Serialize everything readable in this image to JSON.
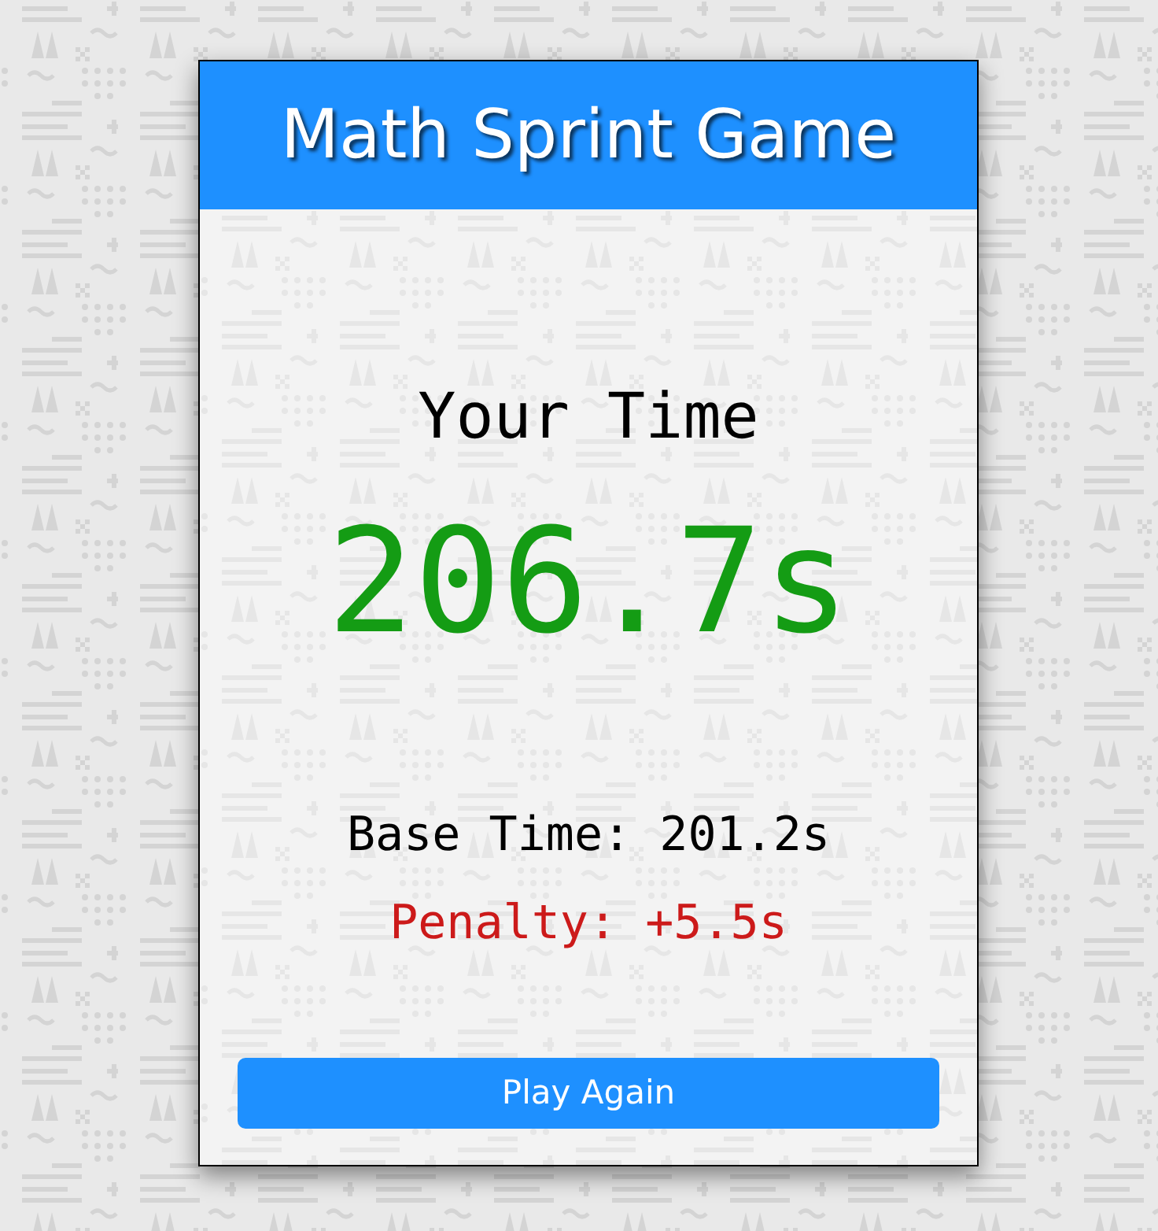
{
  "header": {
    "title": "Math Sprint Game"
  },
  "score": {
    "label": "Your Time",
    "total_time": "206.7s",
    "base_time": "Base Time: 201.2s",
    "penalty": "Penalty: +5.5s"
  },
  "buttons": [
    {
      "label": "Play Again"
    }
  ]
}
